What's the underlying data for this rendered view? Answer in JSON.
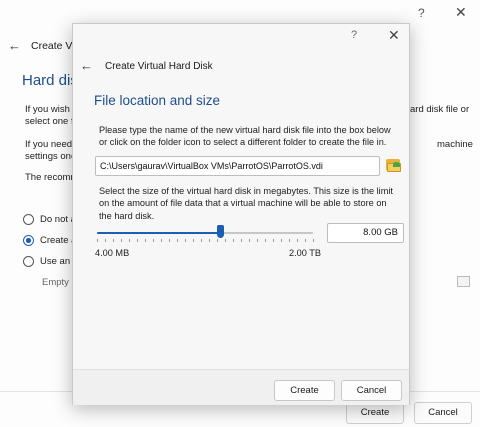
{
  "background_dialog": {
    "help": "?",
    "close": "✕",
    "back": "←",
    "title": "Create Vir",
    "heading": "Hard disk",
    "texts": [
      "If you wish",
      "select one f",
      "If you need",
      "settings one",
      "The recomm"
    ],
    "right_texts": [
      "ard disk file or",
      "machine"
    ],
    "radio_options": [
      {
        "label": "Do not a",
        "selected": false
      },
      {
        "label": "Create a",
        "selected": true
      },
      {
        "label": "Use an e",
        "selected": false
      }
    ],
    "empty_label": "Empty",
    "buttons": {
      "create": "Create",
      "cancel": "Cancel"
    }
  },
  "dialog": {
    "help": "?",
    "close": "✕",
    "back": "←",
    "title": "Create Virtual Hard Disk",
    "heading": "File location and size",
    "file_instructions": "Please type the name of the new virtual hard disk file into the box below or click on the folder icon to select a different folder to create the file in.",
    "file_path": "C:\\Users\\gaurav\\VirtualBox VMs\\ParrotOS\\ParrotOS.vdi",
    "size_instructions": "Select the size of the virtual hard disk in megabytes. This size is the limit on the amount of file data that a virtual machine will be able to store on the hard disk.",
    "size_value": "8.00 GB",
    "slider_fraction": 0.57,
    "tick_count": 28,
    "min_label": "4.00 MB",
    "max_label": "2.00 TB",
    "buttons": {
      "create": "Create",
      "cancel": "Cancel"
    }
  },
  "colors": {
    "accent": "#1a5fb4",
    "heading": "#1f4e8c"
  }
}
